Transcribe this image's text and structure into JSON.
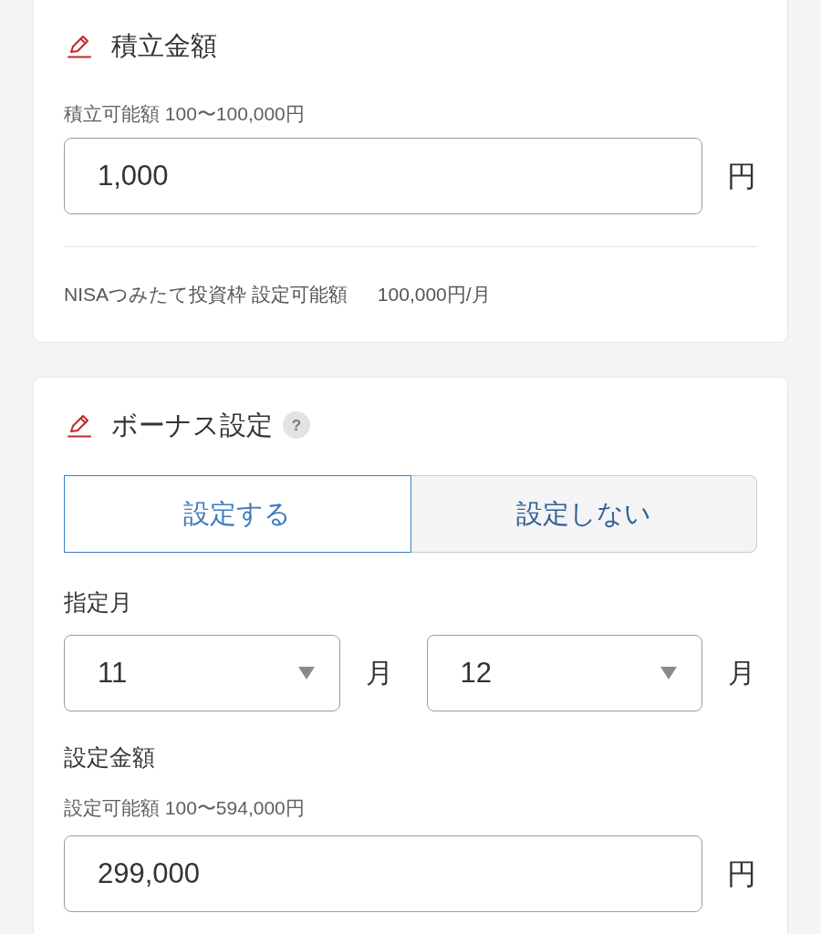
{
  "accumulation": {
    "title": "積立金額",
    "range_note": "積立可能額 100〜100,000円",
    "amount": {
      "value": "1,000",
      "unit": "円"
    },
    "nisa_limit": {
      "label": "NISAつみたて投資枠 設定可能額",
      "value": "100,000円/月"
    }
  },
  "bonus": {
    "title": "ボーナス設定",
    "help": "?",
    "options": [
      {
        "label": "設定する",
        "selected": true
      },
      {
        "label": "設定しない",
        "selected": false
      }
    ],
    "month_label": "指定月",
    "months": [
      {
        "value": "11",
        "unit": "月"
      },
      {
        "value": "12",
        "unit": "月"
      }
    ],
    "amount_label": "設定金額",
    "range_note": "設定可能額 100〜594,000円",
    "amount": {
      "value": "299,000",
      "unit": "円"
    }
  }
}
